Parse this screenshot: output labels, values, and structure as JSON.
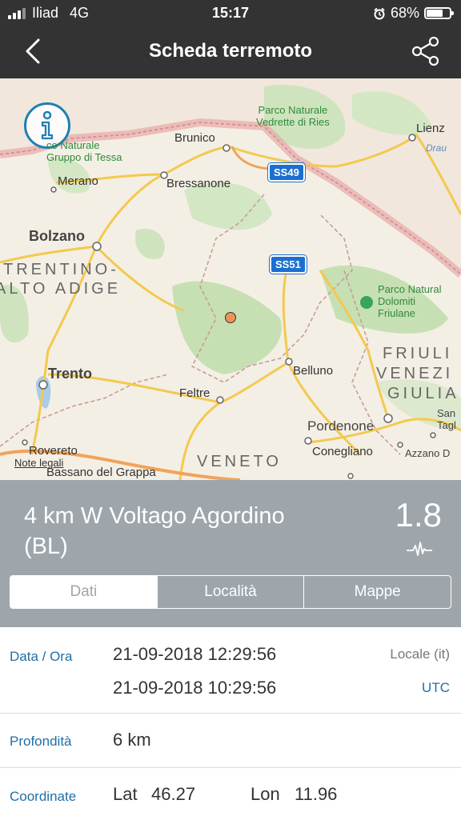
{
  "status": {
    "carrier": "Iliad",
    "network": "4G",
    "time": "15:17",
    "battery": "68%",
    "battery_level": 0.68,
    "icons": [
      "signal-icon",
      "alarm-icon",
      "battery-icon"
    ]
  },
  "nav": {
    "title": "Scheda terremoto",
    "back_icon": "chevron-left-icon",
    "share_icon": "share-icon"
  },
  "map": {
    "places": {
      "brunico": "Brunico",
      "bressanone": "Bressanone",
      "merano": "Merano",
      "bolzano": "Bolzano",
      "lienz": "Lienz",
      "trento": "Trento",
      "belluno": "Belluno",
      "feltre": "Feltre",
      "rovereto": "Rovereto",
      "bassano": "Bassano del Grappa",
      "pordenone": "Pordenone",
      "conegliano": "Conegliano",
      "azzano": "Azzano D",
      "san_tagl_1": "San",
      "san_tagl_2": "Tagl"
    },
    "regions": {
      "trentino_1": "TRENTINO-",
      "trentino_2": "ALTO ADIGE",
      "friuli_1": "FRIULI",
      "friuli_2": "VENEZI",
      "friuli_3": "GIULIA",
      "veneto": "VENETO"
    },
    "parks": {
      "ries_1": "Parco Naturale",
      "ries_2": "Vedrette di Ries",
      "tessa_1": "co Naturale",
      "tessa_2": "Gruppo di Tessa",
      "dolomiti_1": "Parco Natural",
      "dolomiti_2": "Dolomiti",
      "dolomiti_3": "Friulane"
    },
    "roads": {
      "ss49": "SS49",
      "ss51": "SS51"
    },
    "river": "Drau",
    "legal": "Note legali",
    "info_icon": "info-icon"
  },
  "quake": {
    "place_line1": "4 km W Voltago Agordino",
    "place_line2": "(BL)",
    "magnitude": "1.8",
    "wave_icon": "seismograph-icon"
  },
  "tabs": [
    {
      "label": "Dati",
      "active": true
    },
    {
      "label": "Località",
      "active": false
    },
    {
      "label": "Mappe",
      "active": false
    }
  ],
  "details": {
    "datetime_label": "Data / Ora",
    "local_time": "21-09-2018 12:29:56",
    "local_tag": "Locale (it)",
    "utc_time": "21-09-2018 10:29:56",
    "utc_tag": "UTC",
    "depth_label": "Profondità",
    "depth_value": "6 km",
    "coord_label": "Coordinate",
    "lat_label": "Lat",
    "lat_value": "46.27",
    "lon_label": "Lon",
    "lon_value": "11.96"
  },
  "colors": {
    "bar": "#333333",
    "header": "#9ea6ac",
    "label_blue": "#1f6fa8",
    "epicenter": "#f19256"
  }
}
